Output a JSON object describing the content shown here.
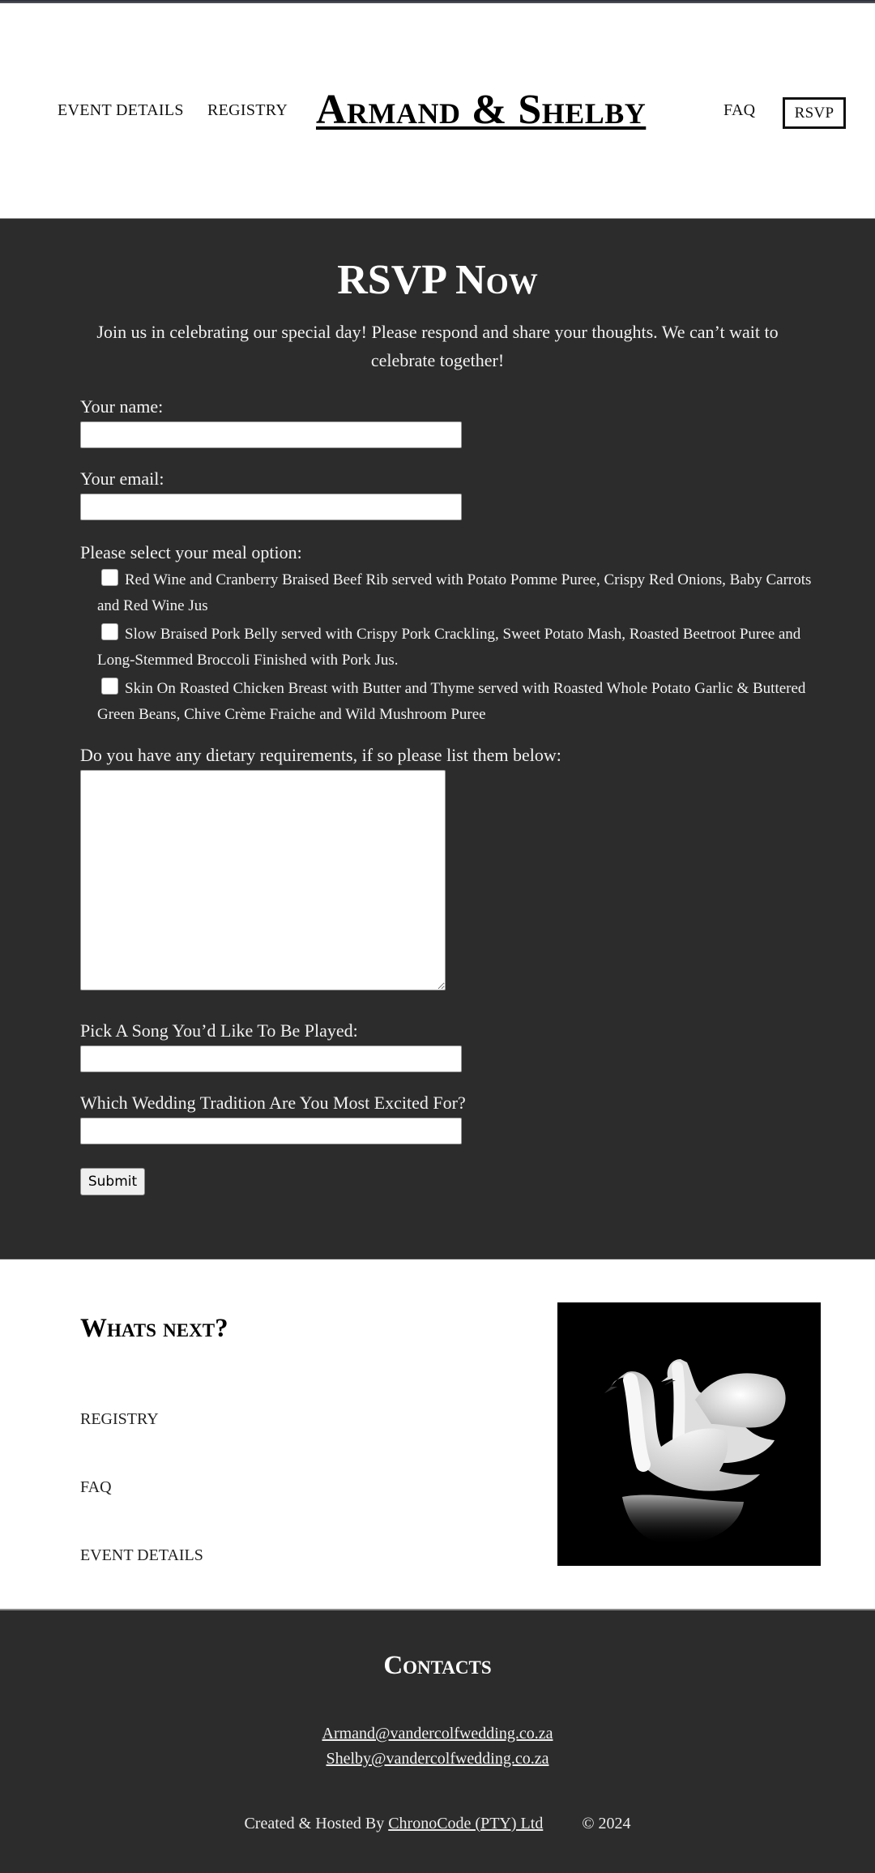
{
  "header": {
    "brand": "Armand & Shelby",
    "nav": {
      "event_details": "EVENT DETAILS",
      "registry": "REGISTRY",
      "faq": "FAQ",
      "rsvp": "RSVP"
    }
  },
  "rsvp": {
    "title": "RSVP Now",
    "intro": "Join us in celebrating our special day! Please respond and share your thoughts. We can’t wait to celebrate together!",
    "form": {
      "name_label": "Your name:",
      "name_value": "",
      "email_label": "Your email:",
      "email_value": "",
      "meal_label": "Please select your meal option:",
      "meal_options": [
        {
          "label": "Red Wine and Cranberry Braised Beef Rib served with Potato Pomme Puree, Crispy Red Onions, Baby Carrots and Red Wine Jus",
          "checked": false
        },
        {
          "label": "Slow Braised Pork Belly served with Crispy Pork Crackling, Sweet Potato Mash, Roasted Beetroot Puree and Long-Stemmed Broccoli Finished with Pork Jus.",
          "checked": false
        },
        {
          "label": "Skin On Roasted Chicken Breast with Butter and Thyme served with Roasted Whole Potato Garlic & Buttered Green Beans, Chive Crème Fraiche and Wild Mushroom Puree",
          "checked": false
        }
      ],
      "diet_label": "Do you have any dietary requirements, if so please list them below:",
      "diet_value": "",
      "song_label": "Pick A Song You’d Like To Be Played:",
      "song_value": "",
      "tradition_label": "Which Wedding Tradition Are You Most Excited For?",
      "tradition_value": "",
      "submit_label": "Submit"
    }
  },
  "whats_next": {
    "title": "Whats next?",
    "links": [
      "REGISTRY",
      "FAQ",
      "EVENT DETAILS"
    ],
    "image_alt": "two-swans-image"
  },
  "footer": {
    "title": "Contacts",
    "emails": [
      "Armand@vandercolfwedding.co.za",
      "Shelby@vandercolfwedding.co.za"
    ],
    "credit_prefix": "Created & Hosted By ",
    "credit_link": "ChronoCode (PTY) Ltd",
    "copyright": "© 2024"
  },
  "colors": {
    "dark_bg": "#2c2c2c",
    "light_bg": "#ffffff",
    "text_light": "#f2f2f2",
    "text_dark": "#000000"
  }
}
